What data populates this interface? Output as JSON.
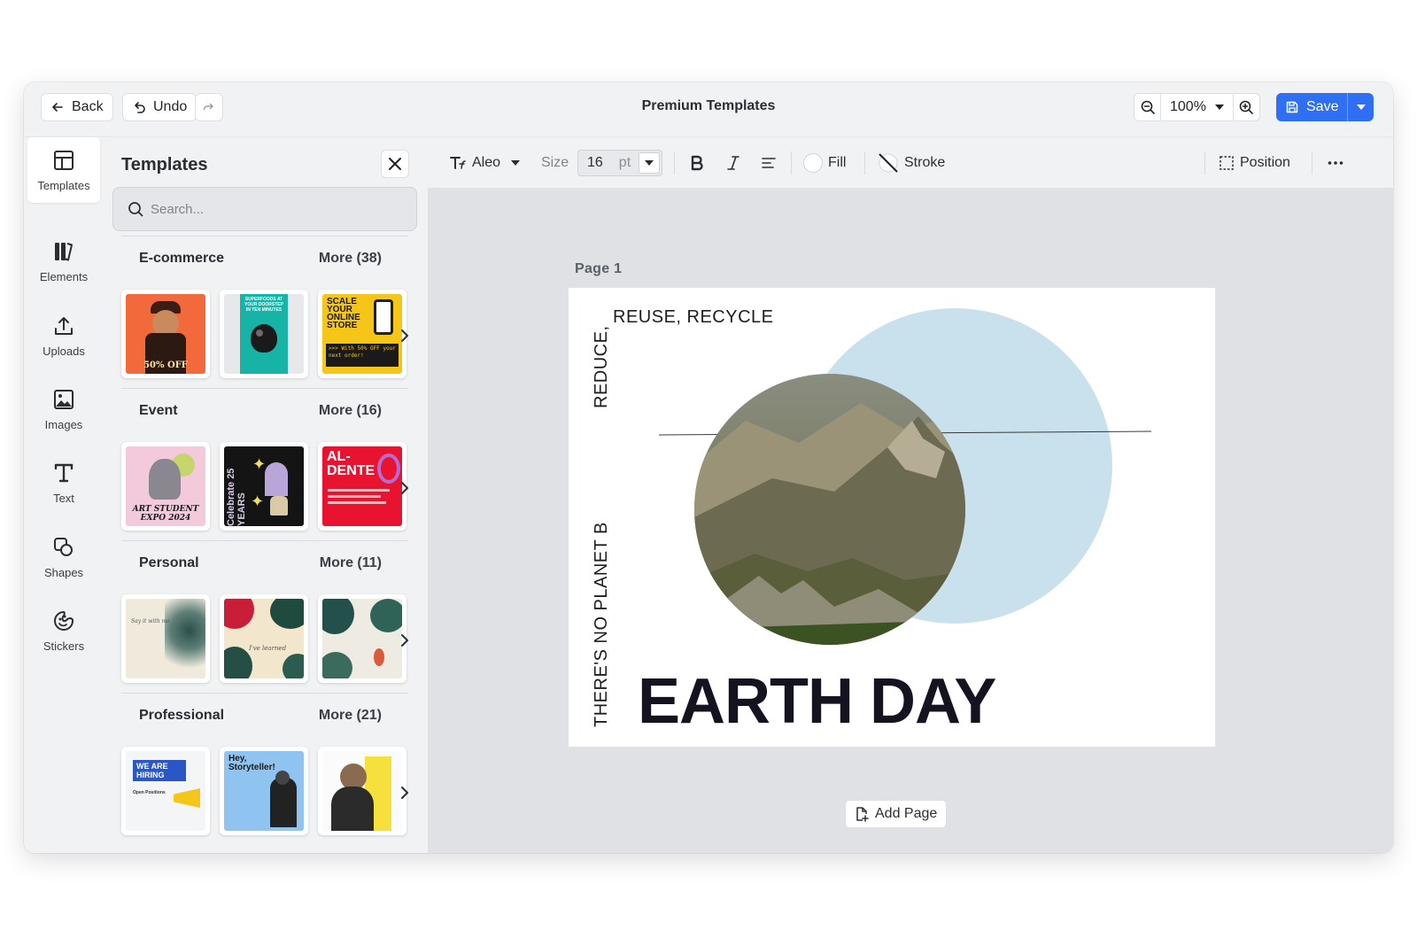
{
  "topbar": {
    "back_label": "Back",
    "undo_label": "Undo",
    "title": "Premium Templates",
    "zoom_value": "100%",
    "save_label": "Save"
  },
  "rail": {
    "items": [
      {
        "label": "Templates",
        "icon": "layout-icon"
      },
      {
        "label": "Elements",
        "icon": "elements-icon"
      },
      {
        "label": "Uploads",
        "icon": "upload-icon"
      },
      {
        "label": "Images",
        "icon": "image-icon"
      },
      {
        "label": "Text",
        "icon": "text-icon"
      },
      {
        "label": "Shapes",
        "icon": "shapes-icon"
      },
      {
        "label": "Stickers",
        "icon": "sticker-icon"
      }
    ]
  },
  "panel": {
    "title": "Templates",
    "search_placeholder": "Search...",
    "sections": [
      {
        "name": "E-commerce",
        "more": "More (38)"
      },
      {
        "name": "Event",
        "more": "More (16)"
      },
      {
        "name": "Personal",
        "more": "More (11)"
      },
      {
        "name": "Professional",
        "more": "More (21)"
      }
    ],
    "thumb_text": {
      "ecom_sale": "50% OFF",
      "ecom_green": "SUPERFOODS AT YOUR DOORSTEP IN TEN MINUTES",
      "ecom_yellow": "SCALE YOUR ONLINE STORE",
      "ecom_yellow_sub": ">>> With 50% OFF your next order!",
      "event_expo": "ART STUDENT EXPO 2024",
      "event_celebrate": "Celebrate 25 YEARS",
      "event_alte": "AL- DENTE",
      "personal_1": "Say it with me",
      "personal_2": "I've learned",
      "pro_hiring": "WE ARE HIRING",
      "pro_hiring_sub": "Open Positions",
      "pro_story": "Hey, Storyteller!"
    }
  },
  "format_bar": {
    "font": "Aleo",
    "size_label": "Size",
    "size_value": "16",
    "size_unit": "pt",
    "fill_label": "Fill",
    "stroke_label": "Stroke",
    "position_label": "Position"
  },
  "canvas": {
    "page_label": "Page  1",
    "reuse_text": "REUSE, RECYCLE",
    "reduce_text": "REDUCE,",
    "planet_text": "THERE'S NO PLANET B",
    "headline": "EARTH DAY",
    "circle_color": "#c8e1ec",
    "add_page_label": "Add Page"
  },
  "colors": {
    "accent": "#2f6ff3",
    "workarea": "#dfe1e4"
  }
}
